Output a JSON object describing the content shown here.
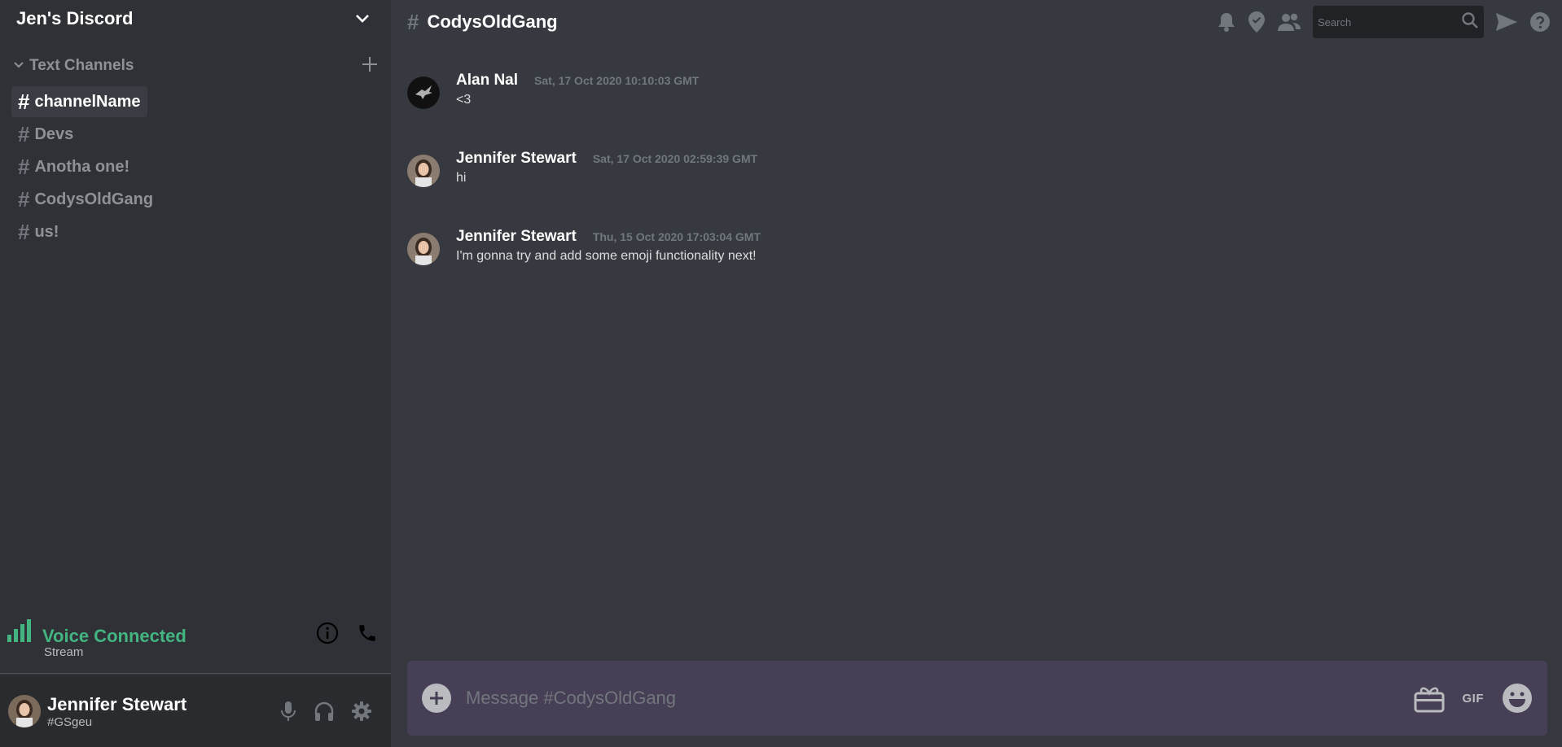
{
  "server": {
    "name": "Jen's Discord"
  },
  "category": {
    "label": "Text Channels"
  },
  "channels": [
    {
      "name": "channelName",
      "active": true
    },
    {
      "name": "Devs"
    },
    {
      "name": "Anotha one!"
    },
    {
      "name": "CodysOldGang"
    },
    {
      "name": "us!"
    }
  ],
  "voice": {
    "status": "Voice Connected",
    "sub": "Stream"
  },
  "user": {
    "name": "Jennifer Stewart",
    "tag": "#GSgeu"
  },
  "header": {
    "channel": "CodysOldGang"
  },
  "search": {
    "placeholder": "Search"
  },
  "messages": [
    {
      "author": "Alan Nal",
      "time": "Sat, 17 Oct 2020 10:10:03 GMT",
      "text": "<3",
      "avatar": "dark-logo"
    },
    {
      "author": "Jennifer Stewart",
      "time": "Sat, 17 Oct 2020 02:59:39 GMT",
      "text": "hi",
      "avatar": "photo"
    },
    {
      "author": "Jennifer Stewart",
      "time": "Thu, 15 Oct 2020 17:03:04 GMT",
      "text": "I'm gonna try and add some emoji functionality next!",
      "avatar": "photo"
    }
  ],
  "composer": {
    "placeholder": "Message #CodysOldGang",
    "gif_label": "GIF"
  },
  "colors": {
    "sidebar": "#2f3136",
    "main": "#36393f",
    "composer": "#473f55",
    "voice_green": "#43b581"
  }
}
